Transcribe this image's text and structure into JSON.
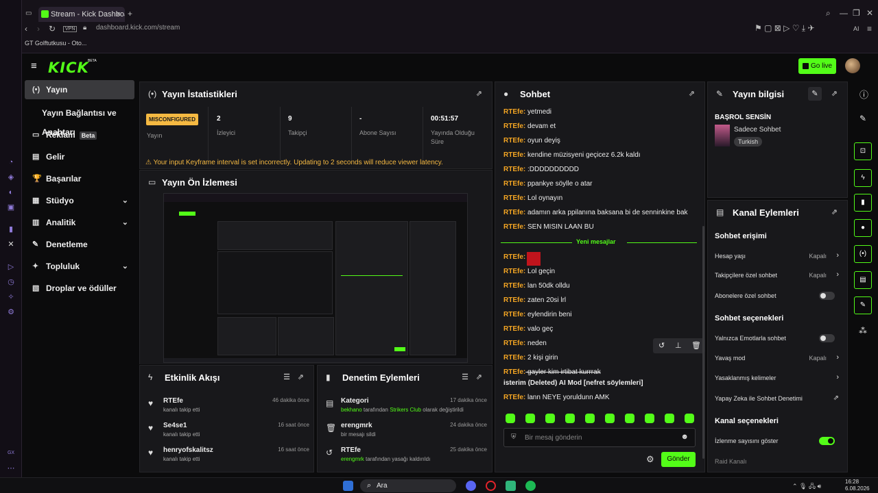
{
  "browser": {
    "tab_title": "Stream - Kick Dashboard",
    "tab_close": "×",
    "new_tab": "+",
    "url": "dashboard.kick.com/stream",
    "vpn": "VPN",
    "bookmark": "GT Golftutkusu - Oto...",
    "ai": "AI"
  },
  "header": {
    "logo": "KICK",
    "logo_beta": "BETA",
    "go_live": "Go live"
  },
  "sidebar": {
    "items": [
      {
        "label": "Yayın",
        "icon": "(•)"
      },
      {
        "label": "Yayın Bağlantısı ve Anahtarı"
      },
      {
        "label": "Reklam",
        "badge": "Beta",
        "icon": "▭"
      },
      {
        "label": "Gelir",
        "icon": "▤"
      },
      {
        "label": "Başarılar",
        "icon": "🏆"
      },
      {
        "label": "Stüdyo",
        "icon": "▦",
        "chev": "⌄"
      },
      {
        "label": "Analitik",
        "icon": "▥",
        "chev": "⌄"
      },
      {
        "label": "Denetleme",
        "icon": "✎"
      },
      {
        "label": "Topluluk",
        "icon": "✦",
        "chev": "⌄"
      },
      {
        "label": "Droplar ve ödüller",
        "icon": "▧"
      }
    ]
  },
  "stats": {
    "title": "Yayın İstatistikleri",
    "status": "MISCONFIGURED",
    "cells": [
      {
        "value": "",
        "label": "Yayın"
      },
      {
        "value": "2",
        "label": "İzleyici"
      },
      {
        "value": "9",
        "label": "Takipçi"
      },
      {
        "value": "-",
        "label": "Abone Sayısı"
      },
      {
        "value": "00:51:57",
        "label": "Yayında Olduğu Süre"
      }
    ],
    "warning": "⚠  Your input Keyframe interval is set incorrectly. Updating to 2 seconds will reduce viewer latency."
  },
  "preview": {
    "title": "Yayın Ön İzlemesi"
  },
  "activity": {
    "title": "Etkinlik Akışı",
    "items": [
      {
        "title": "RTEfe",
        "sub": "kanalı takip etti",
        "time": "46 dakika önce"
      },
      {
        "title": "Se4se1",
        "sub": "kanalı takip etti",
        "time": "16 saat önce"
      },
      {
        "title": "henryofskalitsz",
        "sub": "kanalı takip etti",
        "time": "16 saat önce"
      }
    ]
  },
  "mod_actions": {
    "title": "Denetim Eylemleri",
    "items": [
      {
        "title": "Kategori",
        "sub_a": "bekhano",
        "sub_b": " tarafından ",
        "sub_c": "Strikers Club",
        "sub_d": " olarak değiştirildi",
        "time": "17 dakika önce"
      },
      {
        "title": "erengmrk",
        "sub_d": "bir mesajı sildi",
        "time": "24 dakika önce"
      },
      {
        "title": "RTEfe",
        "sub_a": "erengmrk",
        "sub_d": " tarafından yasağı kaldırıldı",
        "time": "25 dakika önce"
      }
    ]
  },
  "chat": {
    "title": "Sohbet",
    "new_messages": "Yeni mesajlar",
    "placeholder": "Bir mesaj gönderin",
    "send": "Gönder",
    "messages": [
      {
        "user": "RTEfe:",
        "text": " yetmedi"
      },
      {
        "user": "RTEfe:",
        "text": " devam et"
      },
      {
        "user": "RTEfe:",
        "text": " oyun deyiş"
      },
      {
        "user": "RTEfe:",
        "text": " kendine müzisyeni geçicez 6.2k kaldı"
      },
      {
        "user": "RTEfe:",
        "text": " :DDDDDDDDDD"
      },
      {
        "user": "RTEfe:",
        "text": " ppankye söylle o atar"
      },
      {
        "user": "RTEfe:",
        "text": " Lol oynayın"
      },
      {
        "user": "RTEfe:",
        "text": " adamın arka ppilanına baksana bi de senninkine bak"
      },
      {
        "user": "RTEfe:",
        "text": " SEN MISIN LAAN BU"
      },
      {
        "user": "RTEfe:",
        "text": ""
      },
      {
        "user": "RTEfe:",
        "text": " Lol geçin"
      },
      {
        "user": "RTEfe:",
        "text": " lan 50dk olldu"
      },
      {
        "user": "RTEfe:",
        "text": " zaten 20si lrl"
      },
      {
        "user": "RTEfe:",
        "text": " eylendirin beni"
      },
      {
        "user": "RTEfe:",
        "text": " valo geç"
      },
      {
        "user": "RTEfe:",
        "text": " neden"
      },
      {
        "user": "RTEfe:",
        "text": " 2 kişi girin"
      },
      {
        "user": "RTEfe:",
        "text": " gayler kim irtibat kurrrak"
      },
      {
        "user": "",
        "text": "isterim (Deleted)  AI Mod  [nefret söylemleri]"
      },
      {
        "user": "RTEfe:",
        "text": " lann NEYE yoruldunn AMK"
      }
    ]
  },
  "stream_info": {
    "title": "Yayın bilgisi",
    "stream_title": "BAŞROL SENSİN",
    "category": "Sadece Sohbet",
    "language": "Turkish"
  },
  "channel_actions": {
    "title": "Kanal Eylemleri",
    "sec1": "Sohbet erişimi",
    "r1": "Hesap yaşı",
    "r1v": "Kapalı",
    "r2": "Takipçilere özel sohbet",
    "r2v": "Kapalı",
    "r3": "Abonelere özel sohbet",
    "sec2": "Sohbet seçenekleri",
    "r4": "Yalnızca Emotlarla sohbet",
    "r5": "Yavaş mod",
    "r5v": "Kapalı",
    "r6": "Yasaklanmış kelimeler",
    "r7": "Yapay Zeka ile Sohbet Denetimi",
    "sec3": "Kanal seçenekleri",
    "r8": "İzlenme sayısını göster",
    "r9": "Raid Kanalı"
  },
  "taskbar": {
    "search": "Ara",
    "time": "16:28",
    "date": "6.08.2026"
  },
  "colors": {
    "accent": "#53fc18",
    "warn": "#f5b942",
    "bg": "#0b0b0c",
    "panel": "#18181b"
  }
}
